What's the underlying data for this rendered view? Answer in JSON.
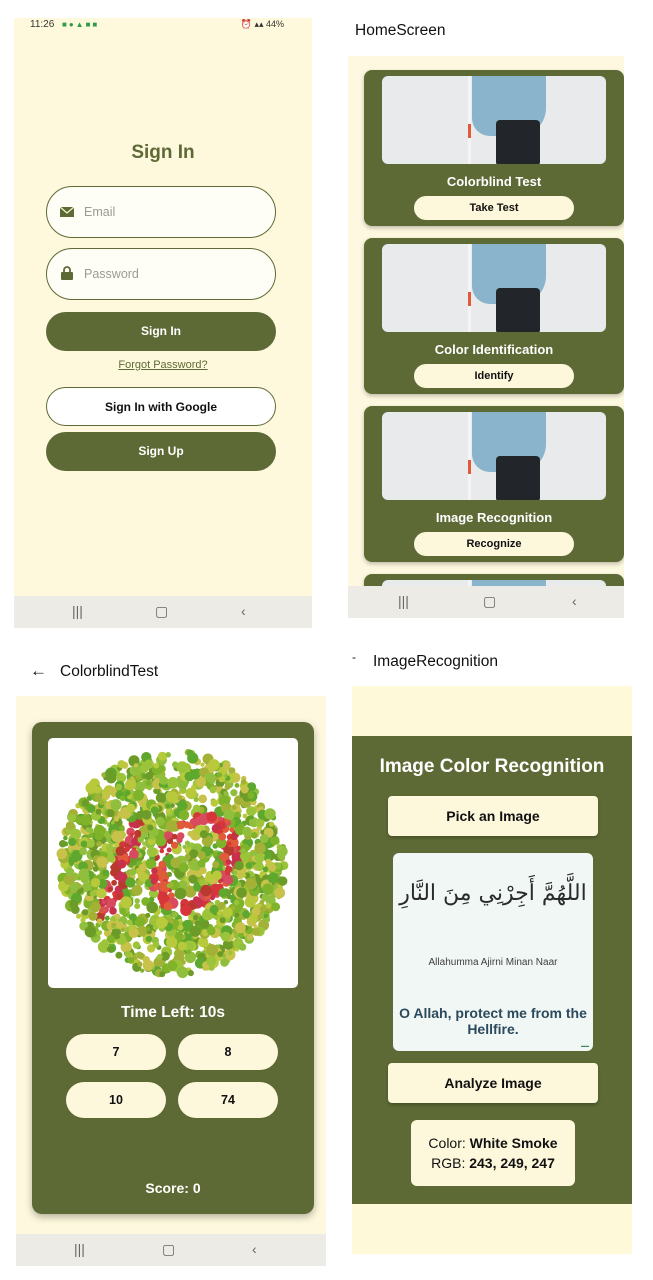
{
  "signin": {
    "status_time": "11:26",
    "status_right": "44%",
    "title": "Sign In",
    "email_placeholder": "Email",
    "password_placeholder": "Password",
    "signin_button": "Sign In",
    "forgot_link": "Forgot Password?",
    "google_button": "Sign In with Google",
    "signup_button": "Sign Up"
  },
  "home": {
    "title": "HomeScreen",
    "cards": [
      {
        "title": "Colorblind Test",
        "button": "Take Test"
      },
      {
        "title": "Color Identification",
        "button": "Identify"
      },
      {
        "title": "Image Recognition",
        "button": "Recognize"
      }
    ]
  },
  "colorblind": {
    "title": "ColorblindTest",
    "time_left": "Time Left: 10s",
    "options": [
      "7",
      "8",
      "10",
      "74"
    ],
    "score": "Score: 0"
  },
  "recognition": {
    "title": "ImageRecognition",
    "panel_title": "Image Color Recognition",
    "pick_button": "Pick an Image",
    "image_arabic": "اللَّهُمَّ أَجِرْنِي مِنَ النَّارِ",
    "image_translit": "Allahumma Ajirni Minan Naar",
    "image_english": "O Allah, protect me from the Hellfire.",
    "analyze_button": "Analyze Image",
    "color_label": "Color: ",
    "color_value": "White Smoke",
    "rgb_label": "RGB: ",
    "rgb_value": "243, 249, 247"
  },
  "nav_icons": [
    "recent-apps-icon",
    "home-icon",
    "back-icon"
  ],
  "colors": {
    "olive": "#5e6a35",
    "cream": "#fdf7dc",
    "background": "#fef9dc"
  }
}
